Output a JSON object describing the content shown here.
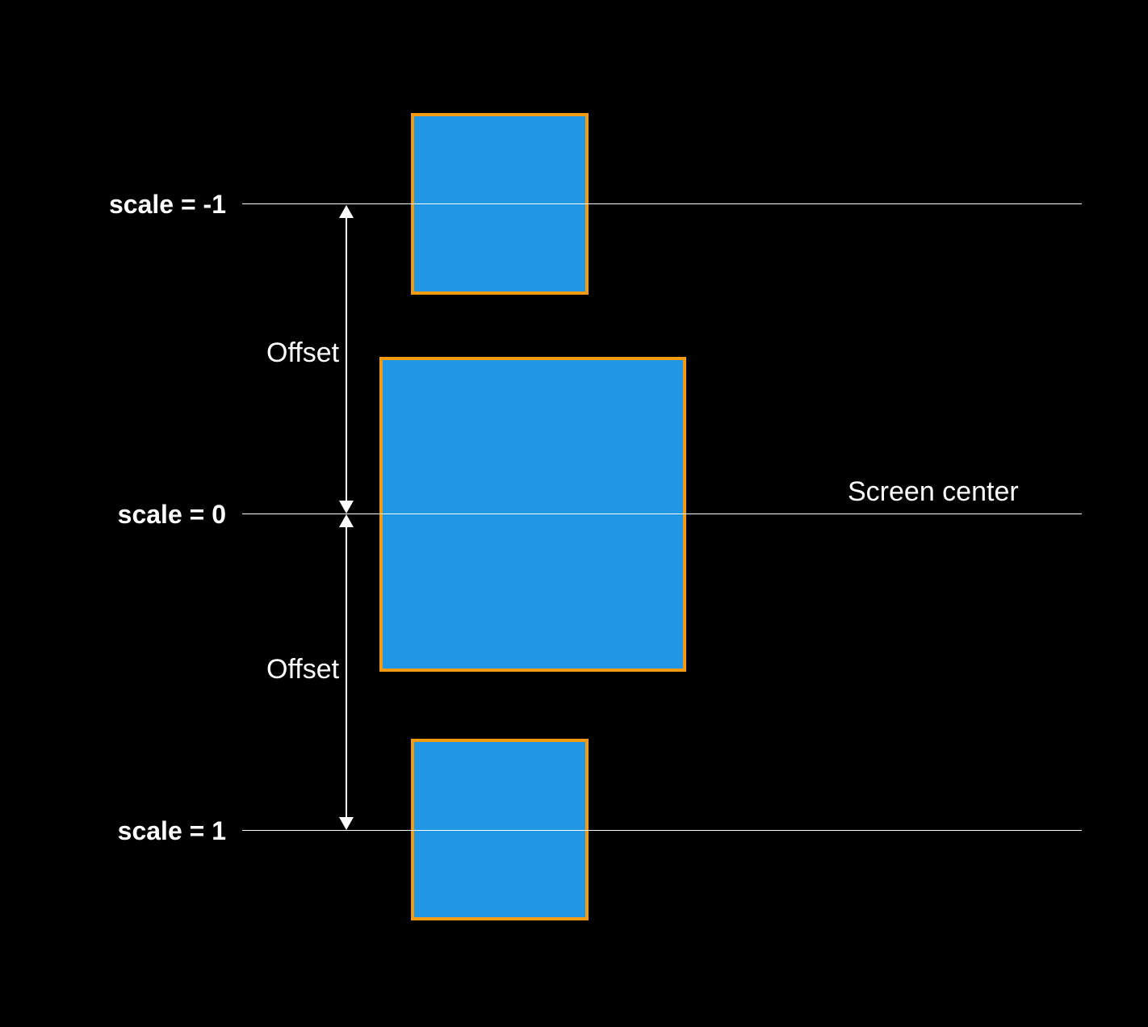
{
  "diagram": {
    "labels": {
      "scaleMinus1": "scale  = -1",
      "scaleZero": "scale = 0",
      "scalePlus1": "scale = 1",
      "screenCenter": "Screen center",
      "offsetUpper": "Offset",
      "offsetLower": "Offset"
    },
    "squares": [
      {
        "id": "top",
        "fill": "#2196e5",
        "stroke": "#f39c12"
      },
      {
        "id": "middle",
        "fill": "#2196e5",
        "stroke": "#f39c12"
      },
      {
        "id": "bottom",
        "fill": "#2196e5",
        "stroke": "#f39c12"
      }
    ],
    "scalePositions": [
      -1,
      0,
      1
    ],
    "colors": {
      "background": "#000000",
      "squareFill": "#2196e5",
      "squareStroke": "#f39c12",
      "line": "#ffffff",
      "text": "#ffffff"
    }
  }
}
